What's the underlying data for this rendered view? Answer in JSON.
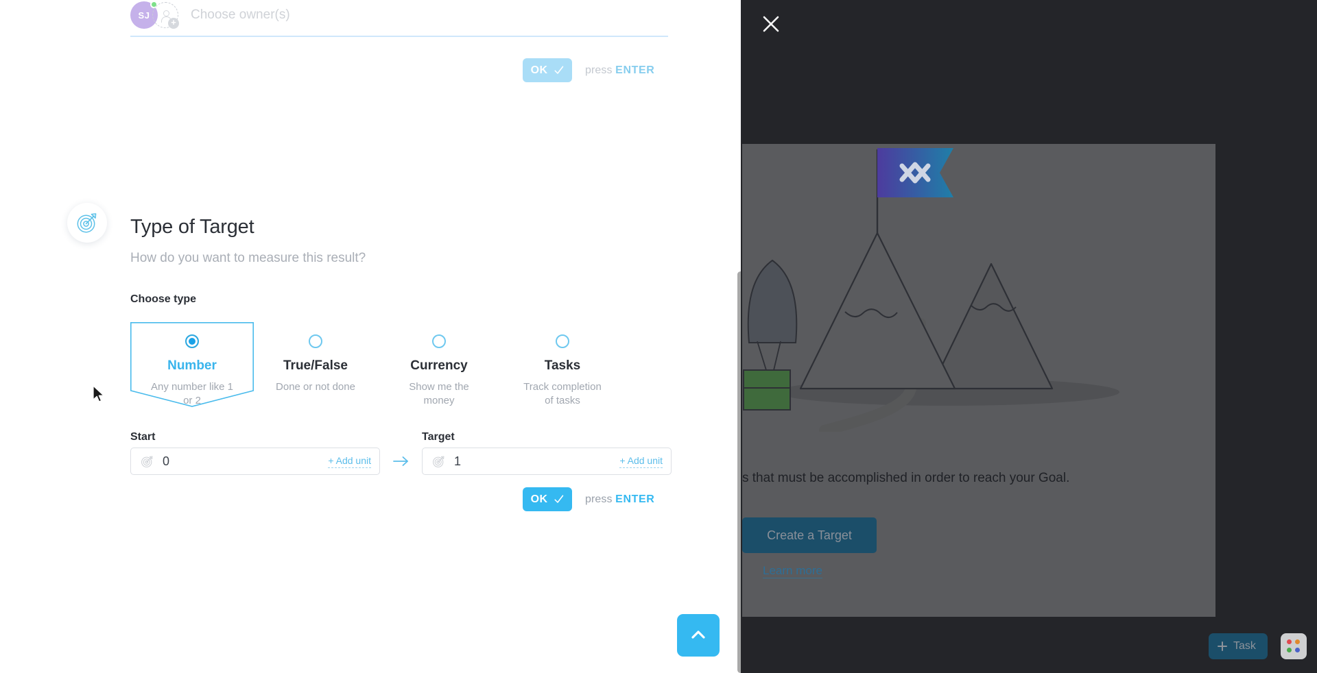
{
  "owners": {
    "avatar_initials": "SJ",
    "add_owner_icon": "add-person-icon",
    "placeholder": "Choose owner(s)"
  },
  "confirm_top": {
    "ok_label": "OK",
    "hint_prefix": "press ",
    "hint_key": "ENTER"
  },
  "section": {
    "icon": "target-icon",
    "title": "Type of Target",
    "subtitle": "How do you want to measure this result?"
  },
  "choose_type": {
    "label": "Choose type",
    "selected": "Number",
    "options": [
      {
        "name": "Number",
        "desc": "Any number like 1 or 2",
        "selected": true
      },
      {
        "name": "True/False",
        "desc": "Done or not done",
        "selected": false
      },
      {
        "name": "Currency",
        "desc": "Show me the money",
        "selected": false
      },
      {
        "name": "Tasks",
        "desc": "Track completion of tasks",
        "selected": false
      }
    ]
  },
  "range": {
    "start_label": "Start",
    "start_value": "0",
    "start_add_unit": "+ Add unit",
    "target_label": "Target",
    "target_value": "1",
    "target_add_unit": "+ Add unit",
    "arrow_icon": "arrow-right-icon"
  },
  "confirm_bottom": {
    "ok_label": "OK",
    "hint_prefix": "press ",
    "hint_key": "ENTER"
  },
  "overlay": {
    "close_icon": "close-icon"
  },
  "behind": {
    "description": "s that must be accomplished in order to reach your Goal.",
    "cta_label": "Create a Target",
    "learn_more": "Learn more",
    "illustration": "mountain-flag-illustration"
  },
  "footer": {
    "task_button_label": "Task",
    "task_plus_icon": "plus-icon",
    "apps_icon": "apps-grid-icon",
    "apps_dot_colors": [
      "#e0494f",
      "#e08a2f",
      "#4aa94a",
      "#4a62c8"
    ]
  },
  "scroll": {
    "up_button_icon": "chevron-up-icon"
  },
  "colors": {
    "accent": "#35b9f1",
    "accent_soft": "#a9ddf7",
    "avatar": "#c5b1ea",
    "status_online": "#7ee08a",
    "text_primary": "#2b2f36",
    "text_muted": "#a1a7b0",
    "overlay_dark": "#242529"
  }
}
